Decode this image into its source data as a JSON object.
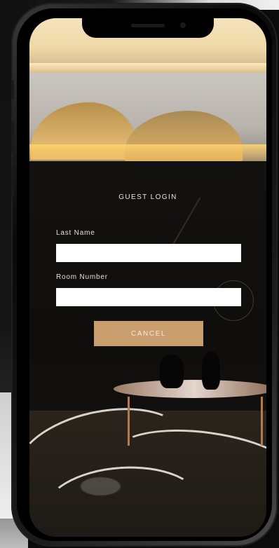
{
  "login": {
    "title": "GUEST LOGIN",
    "last_name_label": "Last Name",
    "last_name_value": "",
    "last_name_placeholder": "",
    "room_number_label": "Room Number",
    "room_number_value": "",
    "room_number_placeholder": "",
    "cancel_label": "CANCEL"
  },
  "colors": {
    "accent": "#c99e6e",
    "input_background": "#ffffff",
    "text": "#e9e3db"
  }
}
